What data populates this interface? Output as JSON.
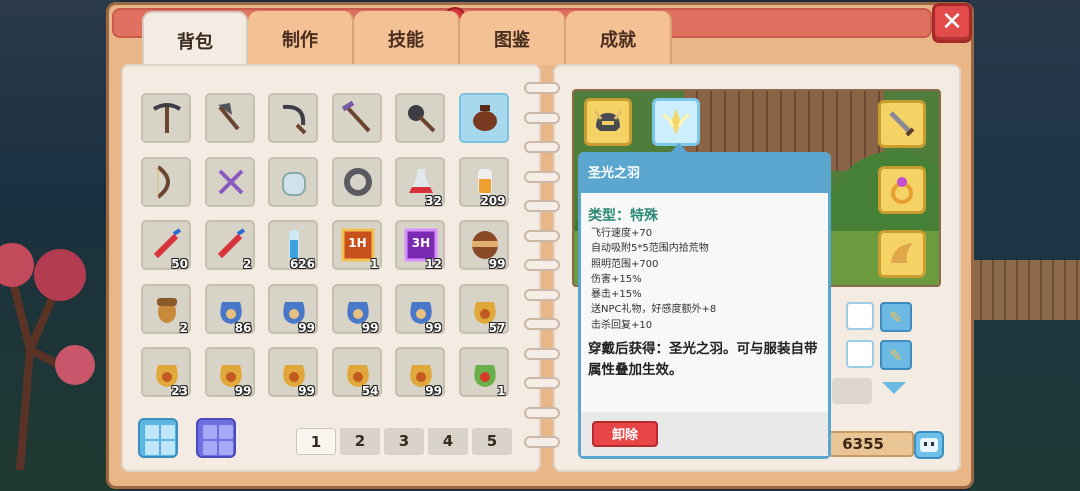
{
  "tabs": [
    "背包",
    "制作",
    "技能",
    "图鉴",
    "成就"
  ],
  "active_tab": 0,
  "close_label": "✕",
  "inventory": {
    "rows": [
      [
        {
          "icon": "pickaxe-icon",
          "count": ""
        },
        {
          "icon": "axe-icon",
          "count": ""
        },
        {
          "icon": "sickle-icon",
          "count": ""
        },
        {
          "icon": "hoe-icon",
          "count": ""
        },
        {
          "icon": "shovel-icon",
          "count": ""
        },
        {
          "icon": "teapot-icon",
          "count": "",
          "highlight": true
        }
      ],
      [
        {
          "icon": "bow-icon",
          "count": ""
        },
        {
          "icon": "scissors-icon",
          "count": ""
        },
        {
          "icon": "jar-icon",
          "count": ""
        },
        {
          "icon": "ring-icon",
          "count": ""
        },
        {
          "icon": "red-potion-icon",
          "count": "32"
        },
        {
          "icon": "orange-bottle-icon",
          "count": "209"
        }
      ],
      [
        {
          "icon": "firework-icon",
          "count": "50"
        },
        {
          "icon": "firework-icon",
          "count": "2"
        },
        {
          "icon": "blue-vial-icon",
          "count": "626"
        },
        {
          "icon": "card-1h-icon",
          "count": "1",
          "label": "1H"
        },
        {
          "icon": "card-3h-icon",
          "count": "12",
          "label": "3H"
        },
        {
          "icon": "barrel-icon",
          "count": "99"
        }
      ],
      [
        {
          "icon": "acorn-icon",
          "count": "2"
        },
        {
          "icon": "blue-seed-bag-icon",
          "count": "86"
        },
        {
          "icon": "blue-seed-bag-icon",
          "count": "99"
        },
        {
          "icon": "blue-seed-bag-icon",
          "count": "99"
        },
        {
          "icon": "blue-seed-bag-icon",
          "count": "99"
        },
        {
          "icon": "gold-seed-bag-icon",
          "count": "57"
        }
      ],
      [
        {
          "icon": "gold-seed-bag-icon",
          "count": "23"
        },
        {
          "icon": "gold-seed-bag-icon",
          "count": "99"
        },
        {
          "icon": "gold-seed-bag-icon",
          "count": "99"
        },
        {
          "icon": "gold-seed-bag-icon",
          "count": "54"
        },
        {
          "icon": "gold-seed-bag-icon",
          "count": "99"
        },
        {
          "icon": "green-seed-bag-icon",
          "count": "1"
        }
      ]
    ]
  },
  "pager": {
    "pages": [
      "1",
      "2",
      "3",
      "4",
      "5"
    ],
    "active": 0
  },
  "tooltip": {
    "title": "圣光之羽",
    "type": "类型：特殊",
    "stats": [
      "飞行速度+70",
      "自动吸附5*5范围内拾荒物",
      "照明范围+700",
      "伤害+15%",
      "暴击+15%",
      "送NPC礼物，好感度额外+8",
      "击杀回复+10"
    ],
    "description": "穿戴后获得：圣光之羽。可与服装自带属性叠加生效。",
    "unequip_label": "卸除"
  },
  "coins": "6355",
  "colors": {
    "tab": "#f3c193",
    "tab_active": "#f4ece3",
    "tooltip_header": "#5aa6cf",
    "type_text": "#2e8a77",
    "unequip": "#e84646"
  }
}
